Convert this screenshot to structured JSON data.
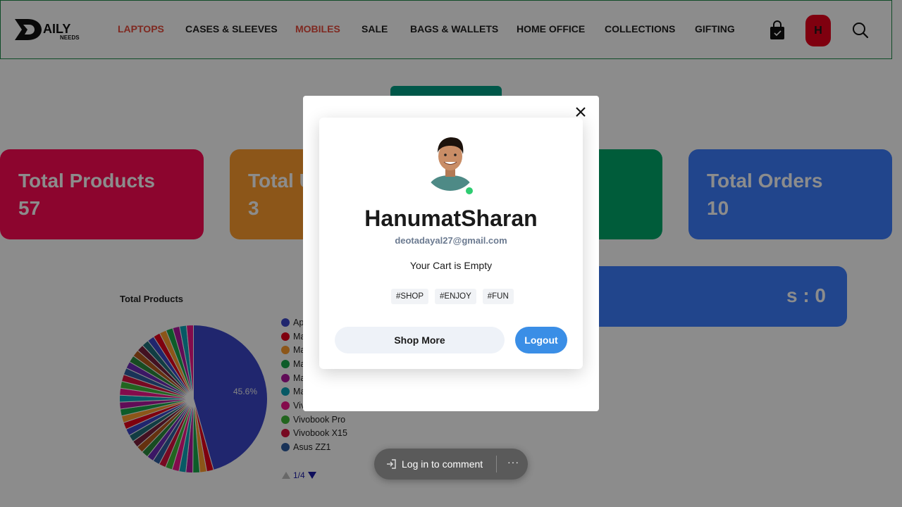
{
  "header": {
    "logo_text_main": "AILY",
    "logo_text_sub": "NEEDS",
    "nav": [
      {
        "label": "LAPTOPS",
        "highlight": true
      },
      {
        "label": "CASES & SLEEVES",
        "highlight": false
      },
      {
        "label": "MOBILES",
        "highlight": true
      },
      {
        "label": "SALE",
        "highlight": false
      },
      {
        "label": "BAGS & WALLETS",
        "highlight": false
      },
      {
        "label": "HOME OFFICE",
        "highlight": false
      },
      {
        "label": "COLLECTIONS",
        "highlight": false
      },
      {
        "label": "GIFTING",
        "highlight": false
      }
    ],
    "avatar_initial": "H"
  },
  "stats": [
    {
      "label": "Total Products",
      "value": "57"
    },
    {
      "label": "Total Users",
      "value": "3"
    },
    {
      "label": "",
      "value": ""
    },
    {
      "label": "Total Orders",
      "value": "10"
    }
  ],
  "pending": "s : 0",
  "chart": {
    "title": "Total Products",
    "slice_label": "45.6%",
    "pager": "1/4"
  },
  "chart_data": {
    "type": "pie",
    "title": "Total Products",
    "legend_visible": [
      "Ap",
      "Ma",
      "Ma",
      "Ma",
      "Ma",
      "Ma",
      "Viv",
      "Vivobook Pro",
      "Vivobook X15",
      "Asus ZZ1"
    ],
    "values": [
      45.6
    ],
    "legend_placement": "right",
    "pager": "1/4"
  },
  "legend": [
    {
      "label": "Ap",
      "color": "#3b46c9"
    },
    {
      "label": "Ma",
      "color": "#e8001c"
    },
    {
      "label": "Ma",
      "color": "#ff9d2e"
    },
    {
      "label": "Ma",
      "color": "#18a84b"
    },
    {
      "label": "Ma",
      "color": "#b0179e"
    },
    {
      "label": "Ma",
      "color": "#0ba3b8"
    },
    {
      "label": "Viv",
      "color": "#f0148a"
    },
    {
      "label": "Vivobook Pro",
      "color": "#3fb83a"
    },
    {
      "label": "Vivobook X15",
      "color": "#d9123e"
    },
    {
      "label": "Asus ZZ1",
      "color": "#2f5da0"
    }
  ],
  "modal": {
    "username": "HanumatSharan",
    "email": "deotadayal27@gmail.com",
    "cart_status": "Your Cart is Empty",
    "tags": [
      "#SHOP",
      "#ENJOY",
      "#FUN"
    ],
    "shop_more": "Shop More",
    "logout": "Logout"
  },
  "comment_bar": {
    "label": "Log in to comment",
    "more": "···"
  },
  "colors": {
    "accent_red": "#ff0a54",
    "accent_orange": "#ff9d2e",
    "accent_green": "#00a86b",
    "accent_blue": "#3d7eff",
    "logout_blue": "#3a8ee6"
  }
}
